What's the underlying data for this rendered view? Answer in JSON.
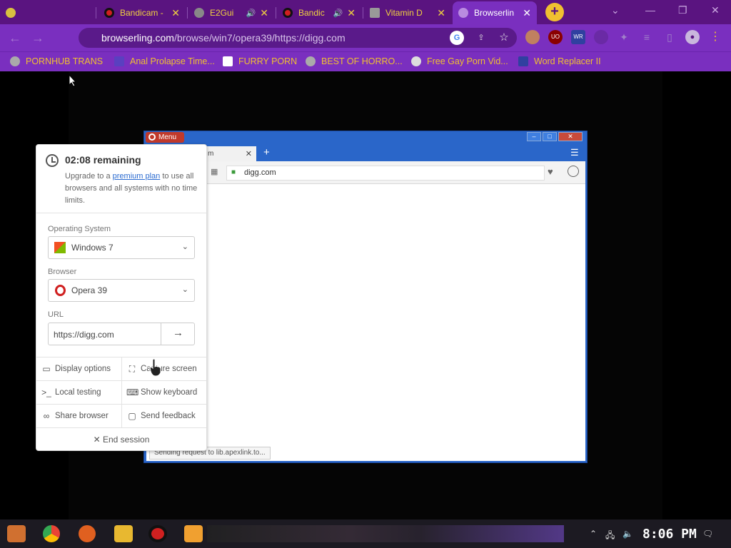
{
  "outer_tabs": [
    {
      "label": "Bandicam -",
      "audio": false
    },
    {
      "label": "E2Gui",
      "audio": true
    },
    {
      "label": "Bandic",
      "audio": true
    },
    {
      "label": "Vitamin D",
      "audio": false
    },
    {
      "label": "Browserlin",
      "audio": false,
      "active": true
    }
  ],
  "address_bar": {
    "host": "browserling.com",
    "path": "/browse/win7/opera39/https://digg.com"
  },
  "bookmarks": [
    {
      "label": "PORNHUB TRANS"
    },
    {
      "label": "Anal Prolapse Time..."
    },
    {
      "label": "FURRY PORN"
    },
    {
      "label": "BEST OF HORRO..."
    },
    {
      "label": "Free Gay Porn Vid..."
    },
    {
      "label": "Word Replacer II"
    }
  ],
  "toolbar_icons": {
    "ublock": "UO",
    "wr": "WR"
  },
  "opera": {
    "menu_label": "Menu",
    "tab_label": "m",
    "address": "digg.com",
    "status": "Sending request to lib.apexlink.to..."
  },
  "panel": {
    "remaining": "02:08 remaining",
    "upgrade_prefix": "Upgrade to a ",
    "upgrade_link": "premium plan",
    "upgrade_suffix": " to use all browsers and all systems with no time limits.",
    "os_label": "Operating System",
    "os_value": "Windows 7",
    "browser_label": "Browser",
    "browser_value": "Opera 39",
    "url_label": "URL",
    "url_value": "https://digg.com",
    "actions": {
      "display_options": "Display options",
      "capture_screen": "Capture screen",
      "local_testing": "Local testing",
      "show_keyboard": "Show keyboard",
      "share_browser": "Share browser",
      "send_feedback": "Send feedback",
      "end_session": "End session"
    }
  },
  "taskbar": {
    "clock": "8:06 PM"
  },
  "colors": {
    "chrome_frame": "#5a1480",
    "chrome_toolbar": "#7a2fbf",
    "accent_yellow": "#f0c030",
    "opera_blue": "#2a66c9"
  }
}
